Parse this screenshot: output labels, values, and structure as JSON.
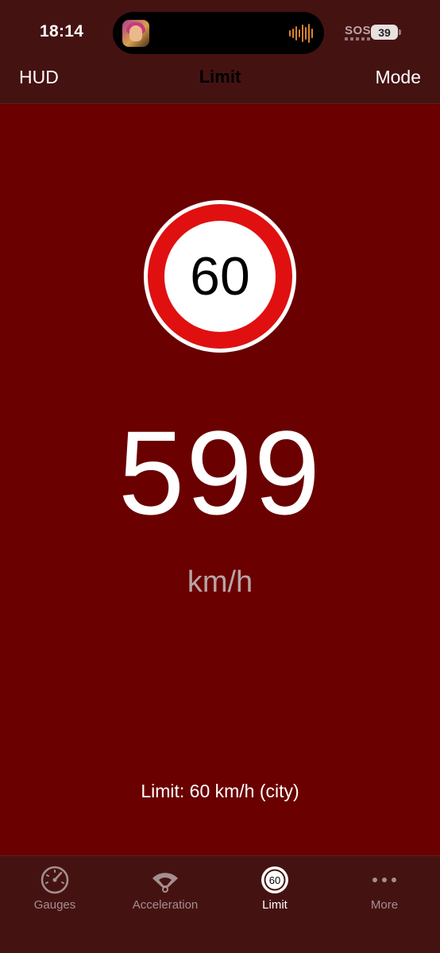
{
  "status_bar": {
    "time": "18:14",
    "sos": "SOS",
    "battery": "39"
  },
  "nav": {
    "left": "HUD",
    "title": "Limit",
    "right": "Mode"
  },
  "sign": {
    "value": "60"
  },
  "speed": {
    "value": "599",
    "unit": "km/h"
  },
  "limit_text": "Limit: 60 km/h (city)",
  "tabs": [
    {
      "label": "Gauges",
      "icon": "gauge-icon",
      "active": false
    },
    {
      "label": "Acceleration",
      "icon": "acceleration-icon",
      "active": false
    },
    {
      "label": "Limit",
      "icon": "speed-limit-icon",
      "active": true,
      "icon_text": "60"
    },
    {
      "label": "More",
      "icon": "more-icon",
      "active": false
    }
  ],
  "colors": {
    "background": "#6a0000",
    "bar": "#451212",
    "sign_red": "#e01010",
    "accent_wave": "#d9822e",
    "inactive_tab": "#a58f8f"
  }
}
